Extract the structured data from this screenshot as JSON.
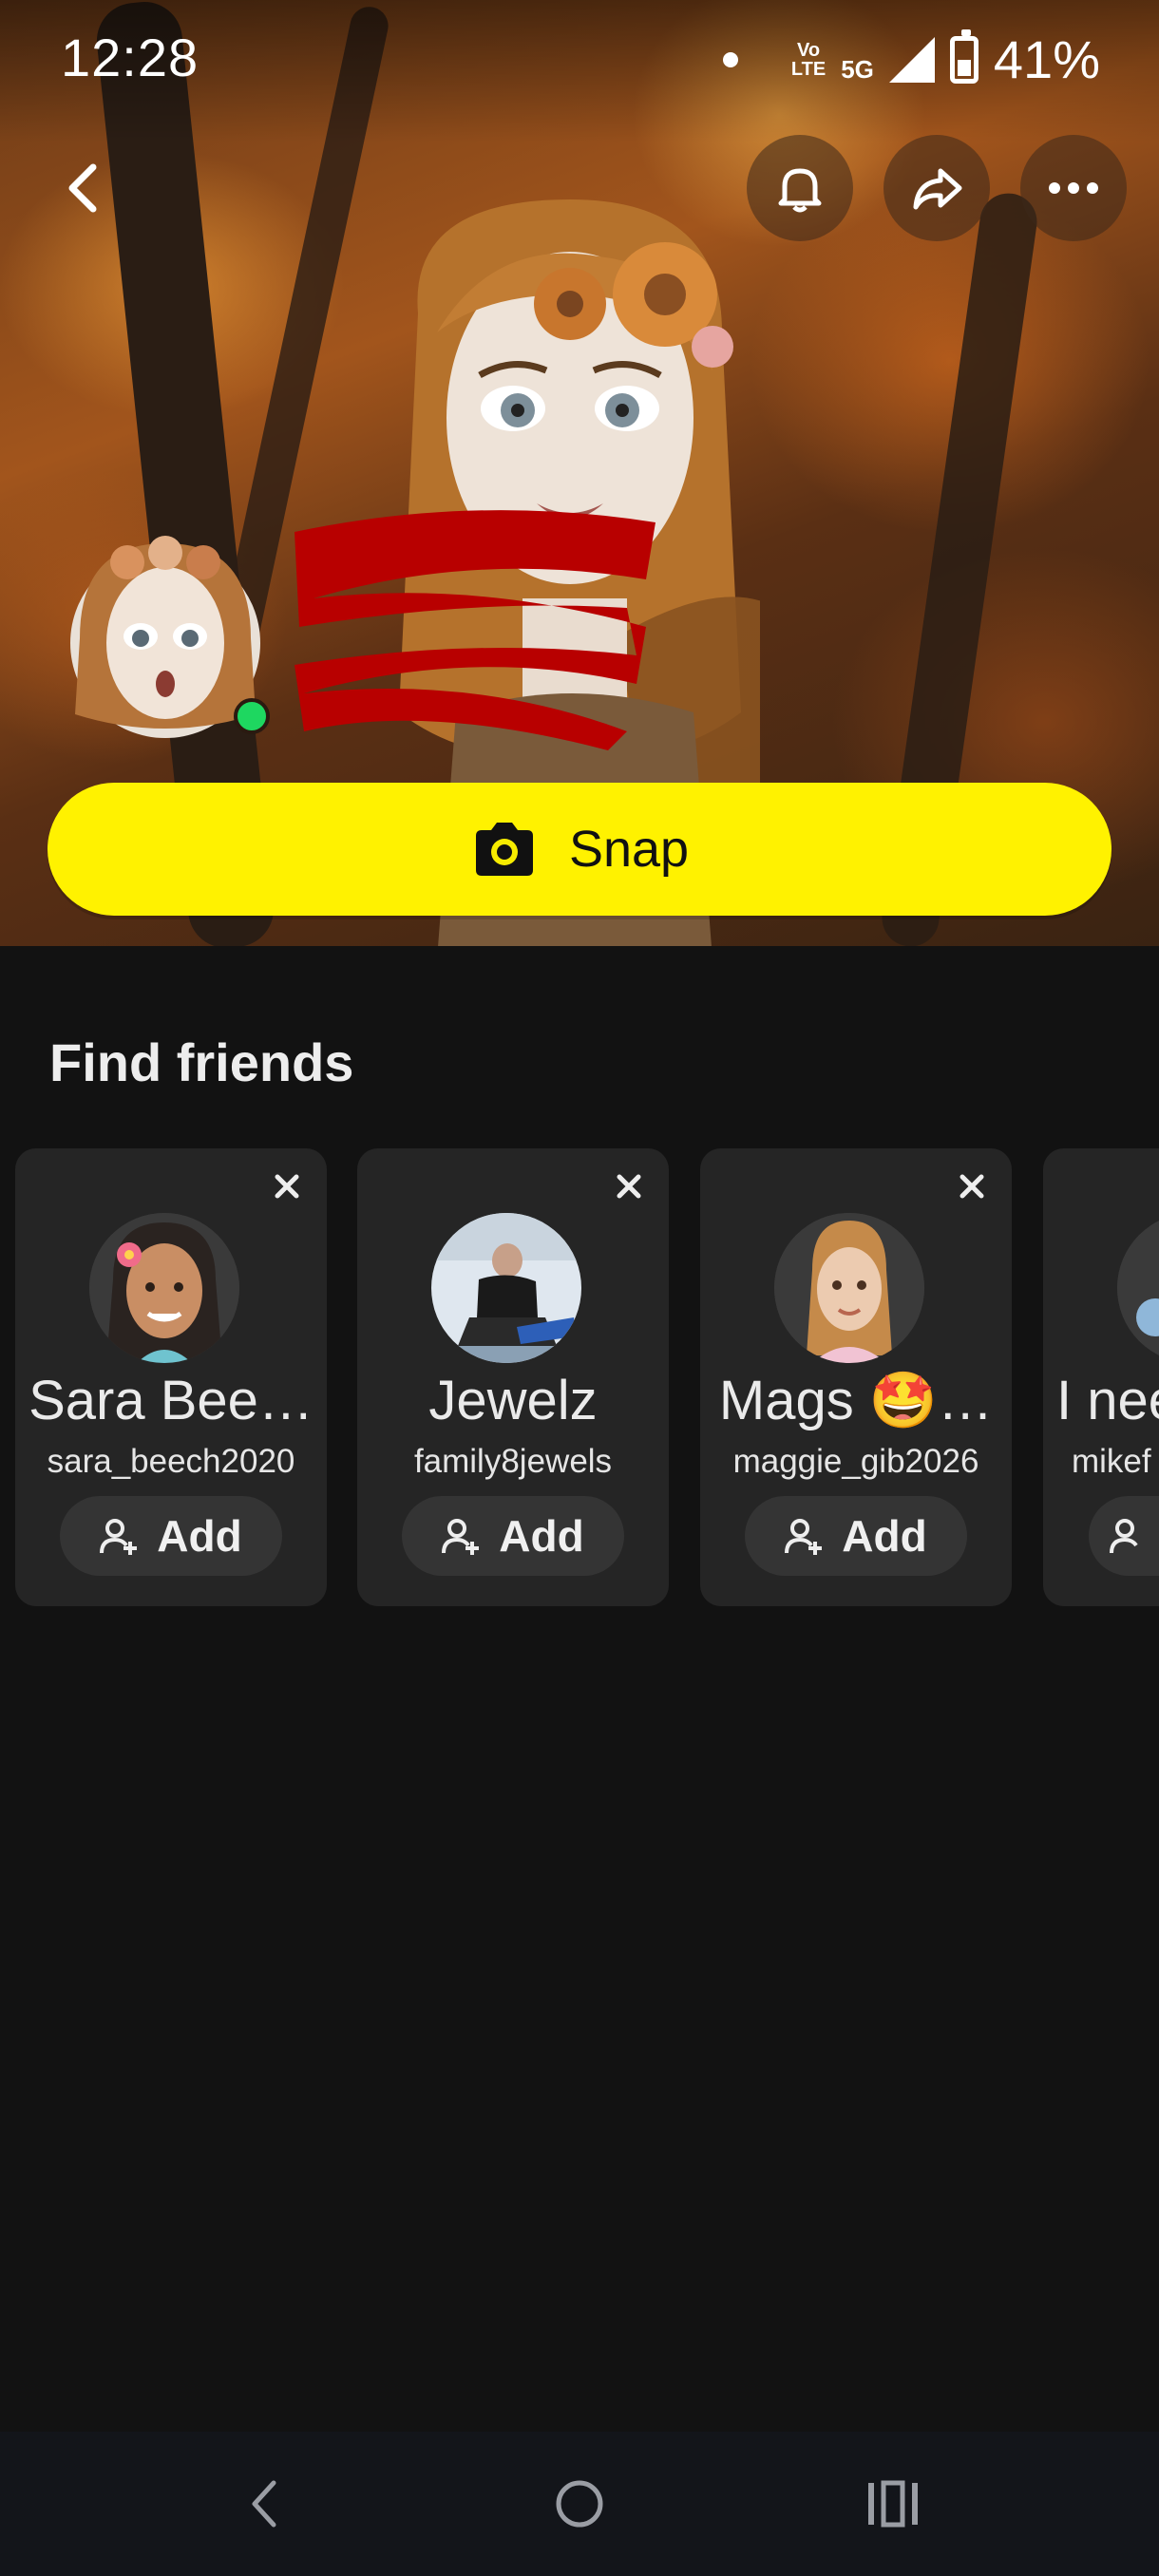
{
  "status_bar": {
    "time": "12:28",
    "volte_top": "Vo",
    "volte_bottom": "LTE",
    "network": "5G",
    "battery": "41%",
    "battery_level": 0.41
  },
  "hero": {
    "snap_button_label": "Snap",
    "online": true
  },
  "find_friends": {
    "title": "Find friends",
    "suggestions": [
      {
        "display_name": "Sara Bee…",
        "username": "sara_beech2020",
        "add_label": "Add"
      },
      {
        "display_name": "Jewelz",
        "username": "family8jewels",
        "add_label": "Add"
      },
      {
        "display_name": "Mags 🤩…",
        "username": "maggie_gib2026",
        "add_label": "Add"
      },
      {
        "display_name": "I nee",
        "username": "mikef",
        "add_label": ""
      }
    ]
  },
  "colors": {
    "snap_yellow": "#FFF200",
    "background": "#121212",
    "card": "#252525",
    "online_green": "#1ED760",
    "redaction": "#B80000"
  },
  "icons": [
    "chevron-left-icon",
    "bell-icon",
    "share-icon",
    "more-icon",
    "camera-icon",
    "close-icon",
    "add-friend-icon",
    "nav-back-icon",
    "nav-home-icon",
    "nav-recents-icon"
  ]
}
